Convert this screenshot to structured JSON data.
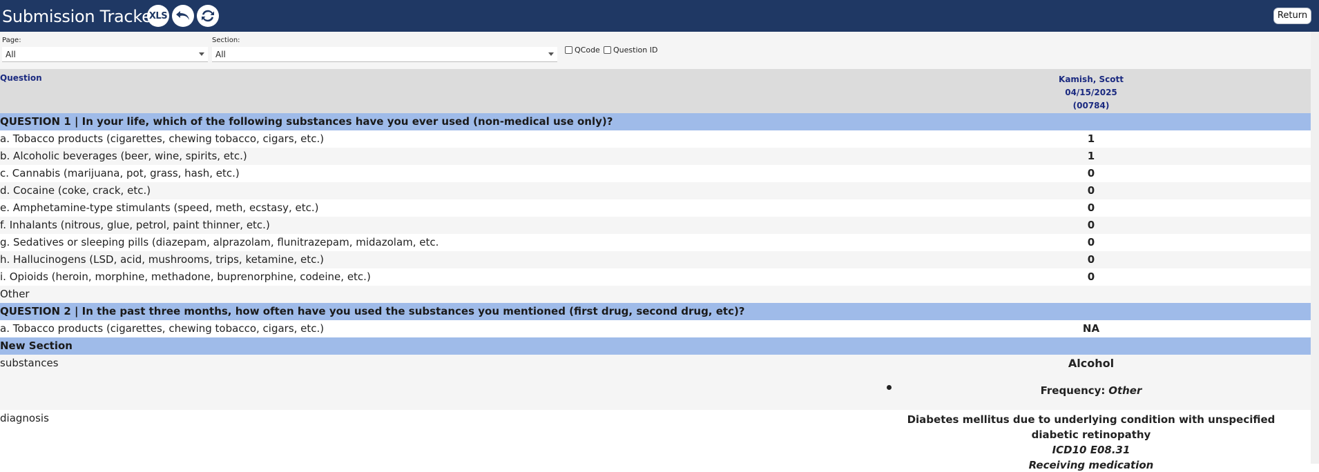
{
  "header": {
    "title": "Submission Tracker",
    "xls_label": "XLS",
    "return_label": "Return"
  },
  "filters": {
    "page_label": "Page:",
    "page_value": "All",
    "section_label": "Section:",
    "section_value": "All",
    "qcode_label": "QCode",
    "questionid_label": "Question ID"
  },
  "table": {
    "question_header": "Question",
    "respondent": {
      "name": "Kamish, Scott",
      "date": "04/15/2025",
      "id": "(00784)"
    },
    "rows": [
      {
        "type": "section",
        "text": "QUESTION 1 | In your life, which of the following substances have you ever used (non-medical use only)?"
      },
      {
        "type": "item",
        "text": "a. Tobacco products (cigarettes, chewing tobacco, cigars, etc.)",
        "value": "1"
      },
      {
        "type": "item",
        "text": "b. Alcoholic beverages (beer, wine, spirits, etc.)",
        "value": "1"
      },
      {
        "type": "item",
        "text": "c. Cannabis (marijuana, pot, grass, hash, etc.)",
        "value": "0"
      },
      {
        "type": "item",
        "text": "d. Cocaine (coke, crack, etc.)",
        "value": "0"
      },
      {
        "type": "item",
        "text": "e. Amphetamine-type stimulants (speed, meth, ecstasy, etc.)",
        "value": "0"
      },
      {
        "type": "item",
        "text": "f. Inhalants (nitrous, glue, petrol, paint thinner, etc.)",
        "value": "0"
      },
      {
        "type": "item",
        "text": "g. Sedatives or sleeping pills (diazepam, alprazolam, flunitrazepam, midazolam, etc.",
        "value": "0"
      },
      {
        "type": "item",
        "text": "h. Hallucinogens (LSD, acid, mushrooms, trips, ketamine, etc.)",
        "value": "0"
      },
      {
        "type": "item",
        "text": "i. Opioids (heroin, morphine, methadone, buprenorphine, codeine, etc.)",
        "value": "0"
      },
      {
        "type": "item",
        "text": "Other",
        "value": ""
      },
      {
        "type": "section",
        "text": "QUESTION 2 | In the past three months, how often have you used the substances you mentioned (first drug, second drug, etc)?"
      },
      {
        "type": "item",
        "text": "a. Tobacco products (cigarettes, chewing tobacco, cigars, etc.)",
        "value": "NA"
      },
      {
        "type": "section",
        "text": "New Section"
      }
    ],
    "substances": {
      "label": "substances",
      "name": "Alcohol",
      "frequency_label": "Frequency:",
      "frequency_value": "Other"
    },
    "diagnosis": {
      "label": "diagnosis",
      "name": "Diabetes mellitus due to underlying condition with unspecified diabetic retinopathy",
      "code": "ICD10 E08.31",
      "status": "Receiving medication"
    }
  }
}
